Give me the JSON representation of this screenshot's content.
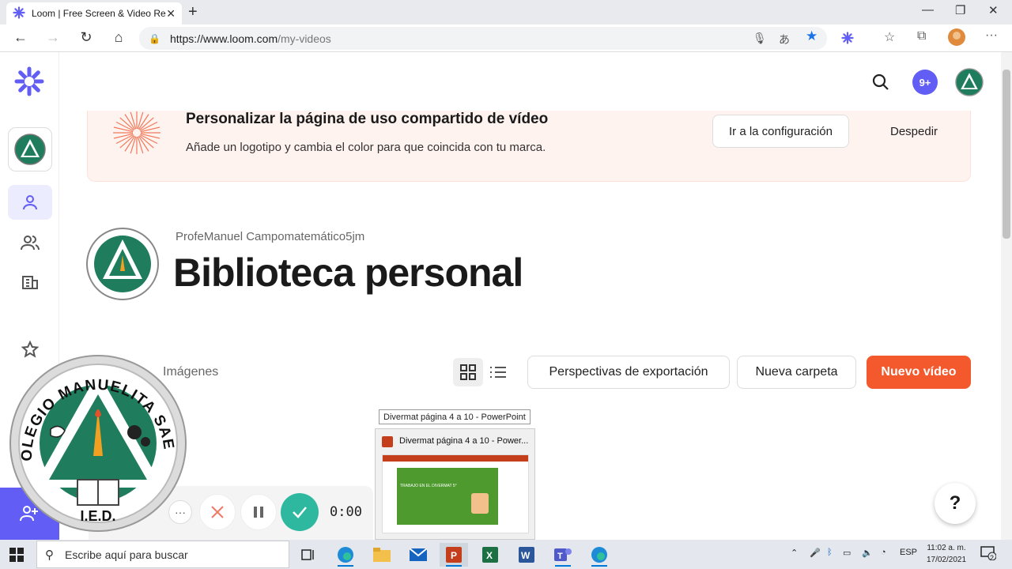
{
  "browser": {
    "tab_title": "Loom | Free Screen & Video Rec",
    "url_host": "https://www.loom.com",
    "url_path": "/my-videos"
  },
  "header": {
    "notifications_count": "9+"
  },
  "banner": {
    "title": "Personalizar la página de uso compartido de vídeo",
    "subtitle": "Añade un logotipo y cambia el color para que coincida con tu marca.",
    "settings_button": "Ir a la configuración",
    "dismiss_button": "Despedir"
  },
  "library": {
    "user_name": "ProfeManuel Campomatemático5jm",
    "title": "Biblioteca personal"
  },
  "toolbar": {
    "images_tab": "Imágenes",
    "export_button": "Perspectivas de exportación",
    "new_folder_button": "Nueva carpeta",
    "new_video_button": "Nuevo vídeo"
  },
  "taskbar_preview": {
    "tooltip": "Divermat página 4 a 10 - PowerPoint",
    "window_title": "Divermat página 4 a 10 - Power...",
    "slide_text": "TRABAJO EN EL DIVERMAT 5°"
  },
  "recorder": {
    "time": "0:00"
  },
  "overlay_logo": {
    "ring_text": "COLEGIO MANUELITA SAENZ",
    "bottom_text": "I.E.D."
  },
  "taskbar": {
    "search_placeholder": "Escribe aquí para buscar",
    "language": "ESP",
    "time": "11:02 a. m.",
    "date": "17/02/2021",
    "notification_count": "2"
  },
  "colors": {
    "brand_purple": "#625df5",
    "accent_orange": "#f4592d"
  }
}
